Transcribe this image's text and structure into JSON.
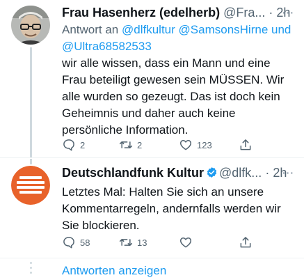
{
  "tweets": [
    {
      "name": "Frau Hasenherz (edelherb)",
      "handle": "@Fra...",
      "separator": "·",
      "time": "2h",
      "more": "···",
      "replying_prefix": "Antwort an",
      "replying_to": [
        "@dlfkultur",
        "@SamsonsHirne",
        "und",
        "@Ultra68582533"
      ],
      "text": "wir alle wissen, dass ein Mann und eine\nFrau beteiligt gewesen sein MÜSSEN. Wir\nalle wurden so gezeugt. Das ist doch kein\nGeheimnis und daher auch keine\npersönliche Information.",
      "replies": "2",
      "retweets": "2",
      "likes": "123"
    },
    {
      "name": "Deutschlandfunk Kultur",
      "verified": true,
      "handle": "@dlfk...",
      "separator": "·",
      "time": "2h",
      "more": "···",
      "text": "Letztes Mal: Halten Sie sich an unsere\nKommentarregeln, andernfalls werden wir\nSie blockieren.",
      "replies": "58",
      "retweets": "13",
      "likes": ""
    }
  ],
  "show_replies_label": "Antworten anzeigen",
  "colors": {
    "accent": "#1d9bf0",
    "secondary_text": "#536471",
    "brand_orange": "#e8622a"
  }
}
